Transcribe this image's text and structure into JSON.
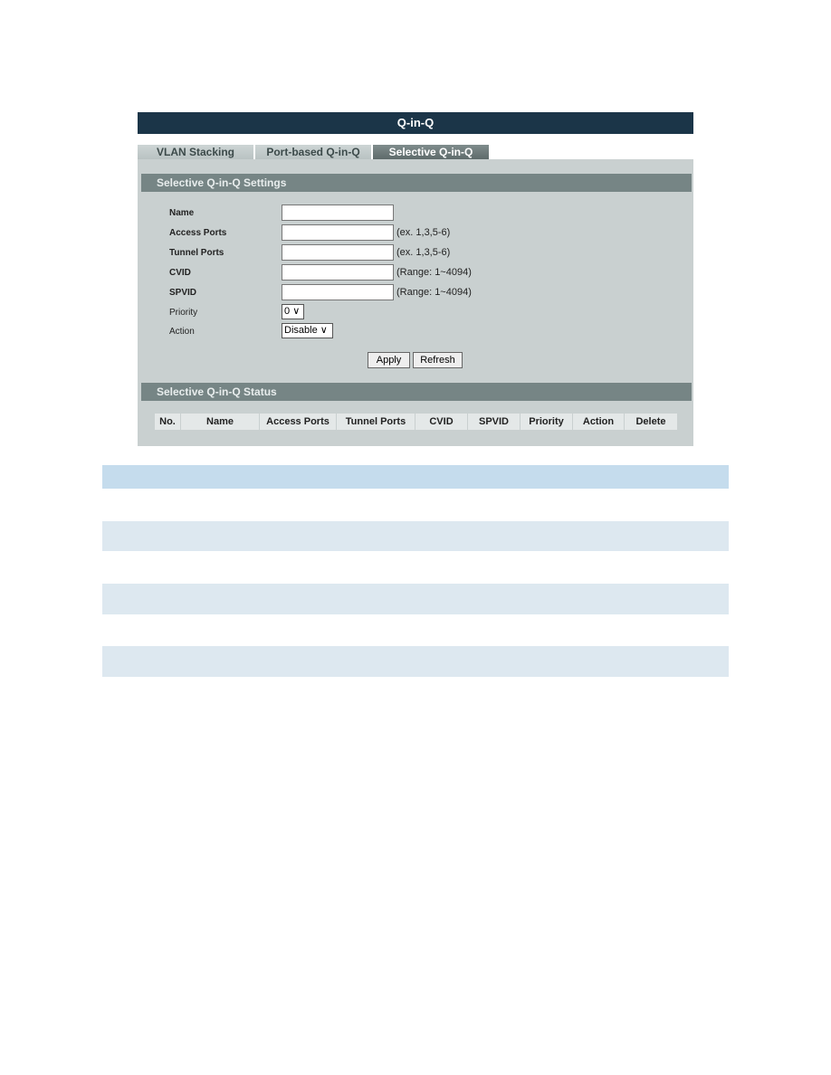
{
  "title": "Q-in-Q",
  "tabs": [
    {
      "label": "VLAN Stacking"
    },
    {
      "label": "Port-based Q-in-Q"
    },
    {
      "label": "Selective Q-in-Q",
      "active": true
    }
  ],
  "settings": {
    "header": "Selective Q-in-Q Settings",
    "name_label": "Name",
    "name_value": "",
    "access_label": "Access Ports",
    "access_value": "",
    "access_hint": "(ex. 1,3,5-6)",
    "tunnel_label": "Tunnel Ports",
    "tunnel_value": "",
    "tunnel_hint": "(ex. 1,3,5-6)",
    "cvid_label": "CVID",
    "cvid_value": "",
    "cvid_hint": "(Range: 1~4094)",
    "spvid_label": "SPVID",
    "spvid_value": "",
    "spvid_hint": "(Range: 1~4094)",
    "priority_label": "Priority",
    "priority_value": "0",
    "action_label": "Action",
    "action_value": "Disable",
    "apply": "Apply",
    "refresh": "Refresh"
  },
  "status": {
    "header": "Selective Q-in-Q Status",
    "columns": [
      "No.",
      "Name",
      "Access Ports",
      "Tunnel Ports",
      "CVID",
      "SPVID",
      "Priority",
      "Action",
      "Delete"
    ]
  },
  "colors": {
    "titlebar": "#1b3548",
    "panel": "#c9d0d0",
    "section": "#768585",
    "band_header": "#c5dced",
    "band": "#dde8f0"
  }
}
